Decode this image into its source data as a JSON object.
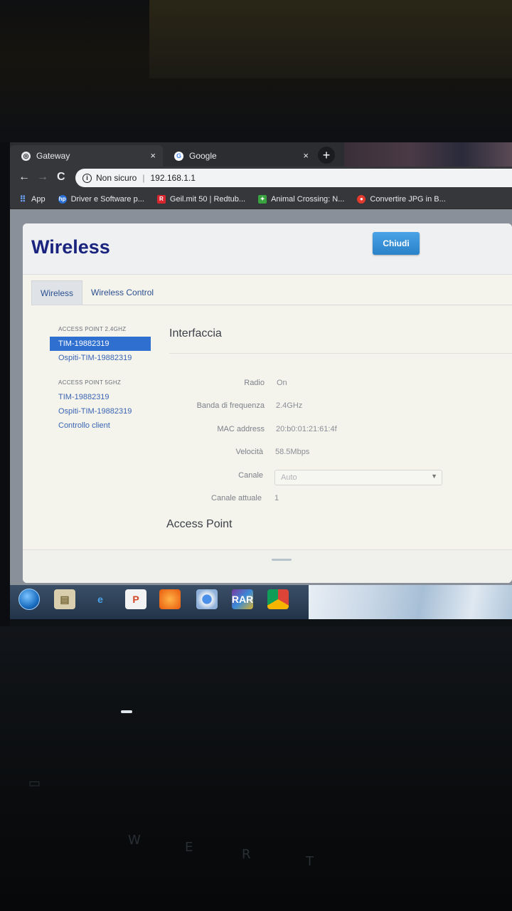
{
  "browser": {
    "tabs": [
      {
        "title": "Gateway",
        "close": "×"
      },
      {
        "title": "Google",
        "close": "×"
      }
    ],
    "new_tab": "+",
    "nav": {
      "back": "←",
      "forward": "→",
      "reload": "C"
    },
    "address": {
      "security": "Non sicuro",
      "url": "192.168.1.1"
    },
    "bookmarks": [
      {
        "label": "App",
        "icon": "apps-grid-icon"
      },
      {
        "label": "Driver e Software p...",
        "icon": "hp-icon"
      },
      {
        "label": "Geil.mit 50 | Redtub...",
        "icon": "red-r-icon"
      },
      {
        "label": "Animal Crossing: N...",
        "icon": "green-leaf-icon"
      },
      {
        "label": "Convertire JPG in B...",
        "icon": "converter-icon"
      }
    ]
  },
  "modal": {
    "title": "Wireless",
    "tabs": [
      "Wireless",
      "Wireless Control"
    ],
    "sidebar": {
      "group_24": "ACCESS POINT 2.4GHZ",
      "items_24": [
        "TIM-19882319",
        "Ospiti-TIM-19882319"
      ],
      "group_5": "ACCESS POINT 5GHZ",
      "items_5": [
        "TIM-19882319",
        "Ospiti-TIM-19882319",
        "Controllo client"
      ]
    },
    "section_interfaccia": "Interfaccia",
    "fields": {
      "radio": {
        "label": "Radio",
        "value": "On"
      },
      "banda": {
        "label": "Banda di frequenza",
        "value": "2.4GHz"
      },
      "mac": {
        "label": "MAC address",
        "value": "20:b0:01:21:61:4f"
      },
      "velocita": {
        "label": "Velocità",
        "value": "58.5Mbps"
      },
      "canale": {
        "label": "Canale",
        "value": "Auto"
      },
      "canale_attuale": {
        "label": "Canale attuale",
        "value": "1"
      }
    },
    "section_access_point": "Access Point",
    "close_button": "Chiudi"
  },
  "colors": {
    "title_blue": "#1a237e",
    "link_blue": "#3a65b4",
    "active_item": "#2f6fd0",
    "button_blue": "#2a82c9"
  }
}
